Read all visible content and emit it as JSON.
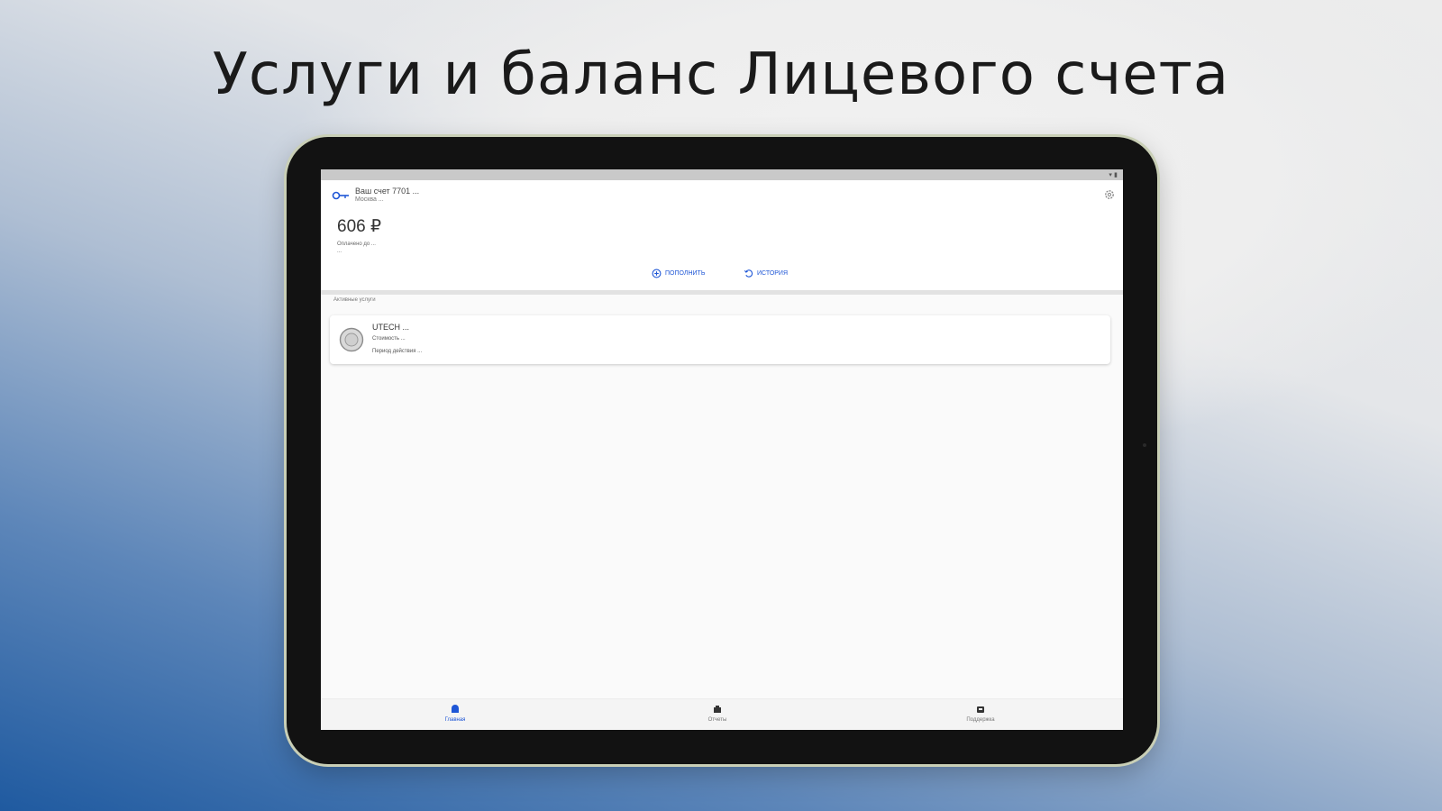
{
  "headline": "Услуги и баланс Лицевого счета",
  "status_bar": {
    "icons": "▾ ▮"
  },
  "account": {
    "title": "Ваш счет 7701 ...",
    "subtitle": "Москва ..."
  },
  "balance": {
    "amount": "606 ₽",
    "note_line1": "Оплачено до ...",
    "note_line2": "..."
  },
  "actions": {
    "topup_label": "ПОПОЛНИТЬ",
    "history_label": "ИСТОРИЯ"
  },
  "services": {
    "section_label": "Активные услуги",
    "items": [
      {
        "name": "UTECH ...",
        "price": "Стоимость ...",
        "date": "Период действия ..."
      }
    ]
  },
  "bottom_nav": {
    "items": [
      {
        "label": "Главная"
      },
      {
        "label": "Отчеты"
      },
      {
        "label": "Поддержка"
      }
    ]
  },
  "colors": {
    "accent": "#1e56d6",
    "tablet_frame": "#121212"
  }
}
